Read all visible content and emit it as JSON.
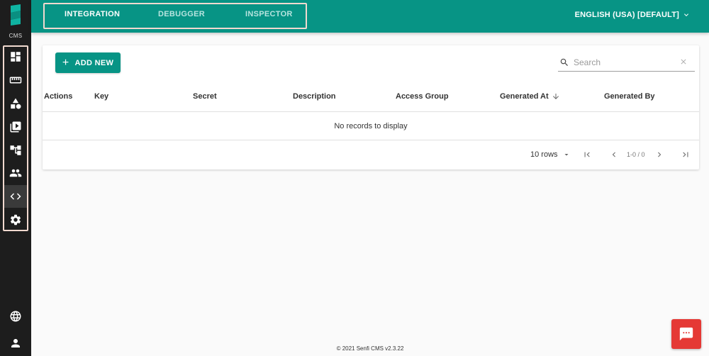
{
  "app": {
    "cms_label": "CMS"
  },
  "header": {
    "tabs": [
      {
        "label": "INTEGRATION",
        "active": true
      },
      {
        "label": "DEBUGGER",
        "active": false
      },
      {
        "label": "INSPECTOR",
        "active": false
      }
    ],
    "language": "ENGLISH (USA) [DEFAULT]"
  },
  "sidebar": {
    "items": [
      {
        "icon": "dashboard-icon"
      },
      {
        "icon": "ruler-icon"
      },
      {
        "icon": "shapes-icon"
      },
      {
        "icon": "media-library-icon"
      },
      {
        "icon": "hierarchy-icon"
      },
      {
        "icon": "users-icon"
      },
      {
        "icon": "code-icon",
        "active": true
      },
      {
        "icon": "gear-icon"
      }
    ],
    "bottom_items": [
      {
        "icon": "globe-icon"
      },
      {
        "icon": "account-icon"
      }
    ]
  },
  "main": {
    "add_button": "ADD NEW",
    "search": {
      "placeholder": "Search",
      "value": ""
    },
    "table": {
      "columns": [
        "Actions",
        "Key",
        "Secret",
        "Description",
        "Access Group",
        "Generated At",
        "Generated By"
      ],
      "sorted_column": "Generated At",
      "sort_direction": "descending",
      "empty_message": "No records to display"
    },
    "pagination": {
      "rows_per_page": "10 rows",
      "range": "1-0 / 0"
    }
  },
  "footer": {
    "text": "© 2021 Senfi CMS v2.3.22"
  },
  "colors": {
    "accent": "#079485",
    "sidebar": "#1d1d1d",
    "chat": "#e53935",
    "highlight_border": "#f1d9cf"
  }
}
